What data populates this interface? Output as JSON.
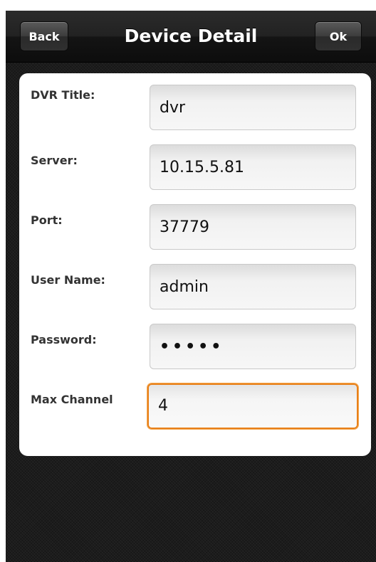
{
  "header": {
    "back_label": "Back",
    "title": "Device Detail",
    "ok_label": "Ok"
  },
  "form": {
    "dvr_title": {
      "label": "DVR Title:",
      "value": "dvr"
    },
    "server": {
      "label": "Server:",
      "value": "10.15.5.81"
    },
    "port": {
      "label": "Port:",
      "value": "37779"
    },
    "user_name": {
      "label": "User Name:",
      "value": "admin"
    },
    "password": {
      "label": "Password:",
      "value": "•••••"
    },
    "max_channel": {
      "label": "Max Channel",
      "value": "4"
    }
  },
  "colors": {
    "focus_border": "#e8801a",
    "background": "#1c1c1c"
  }
}
